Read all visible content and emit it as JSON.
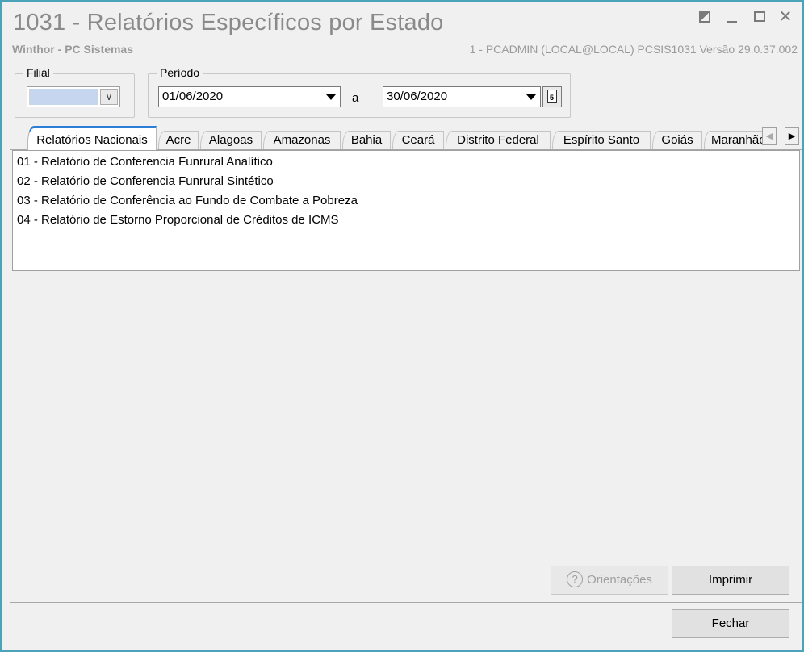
{
  "window": {
    "title": "1031 - Relatórios Específicos por Estado",
    "subtitle": "Winthor - PC Sistemas",
    "user_info": "1 - PCADMIN (LOCAL@LOCAL)   PCSIS1031  Versão  29.0.37.002",
    "controls": {
      "min": "_",
      "close": "✕"
    }
  },
  "filial": {
    "legend": "Filial",
    "value": "",
    "dropdown_glyph": "∨"
  },
  "periodo": {
    "legend": "Período",
    "start_date": "01/06/2020",
    "separator": "a",
    "end_date": "30/06/2020",
    "calendar_num": "5"
  },
  "tabs": [
    {
      "label": "Relatórios Nacionais",
      "active": true
    },
    {
      "label": "Acre"
    },
    {
      "label": "Alagoas"
    },
    {
      "label": "Amazonas"
    },
    {
      "label": "Bahia"
    },
    {
      "label": "Ceará"
    },
    {
      "label": "Distrito Federal"
    },
    {
      "label": "Espírito Santo"
    },
    {
      "label": "Goiás"
    },
    {
      "label": "Maranhão"
    }
  ],
  "tab_scroll": {
    "left": "◀",
    "right": "▶"
  },
  "reports": [
    "01 - Relatório de Conferencia Funrural Analítico",
    "02 - Relatório de Conferencia Funrural Sintético",
    "03 - Relatório de Conferência ao Fundo de Combate a Pobreza",
    "04 - Relatório de Estorno Proporcional de Créditos de ICMS"
  ],
  "buttons": {
    "orientacoes": "Orientações",
    "orientacoes_icon": "?",
    "imprimir": "Imprimir",
    "fechar": "Fechar"
  },
  "colors": {
    "window_border": "#4aa3b8",
    "active_tab_accent": "#2d7ed6",
    "selection": "#c7d6ef"
  }
}
